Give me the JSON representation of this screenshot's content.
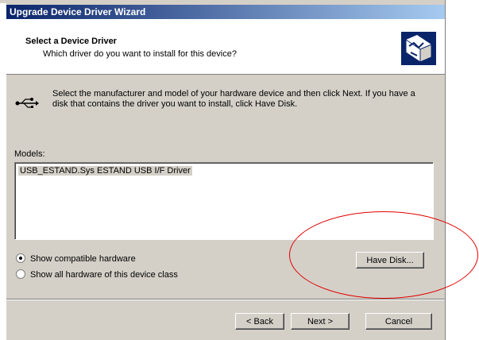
{
  "window": {
    "title": "Upgrade Device Driver Wizard"
  },
  "header": {
    "title": "Select a Device Driver",
    "subtitle": "Which driver do you want to install for this device?",
    "icon": "hardware-wizard-icon"
  },
  "body": {
    "icon": "usb-icon",
    "instructions": "Select the manufacturer and model of your hardware device and then click Next. If you have a disk that contains the driver you want to install, click Have Disk.",
    "models_label": "Models:",
    "models": [
      "USB_ESTAND.Sys ESTAND USB I/F Driver"
    ],
    "selected_model_index": 0
  },
  "options": {
    "compatible": {
      "label": "Show compatible hardware",
      "checked": true
    },
    "all": {
      "label": "Show all hardware of this device class",
      "checked": false
    }
  },
  "buttons": {
    "have_disk": "Have Disk...",
    "back": "< Back",
    "next": "Next >",
    "cancel": "Cancel"
  },
  "annotation": {
    "color": "#e00000",
    "shape": "ellipse around Have Disk button"
  }
}
